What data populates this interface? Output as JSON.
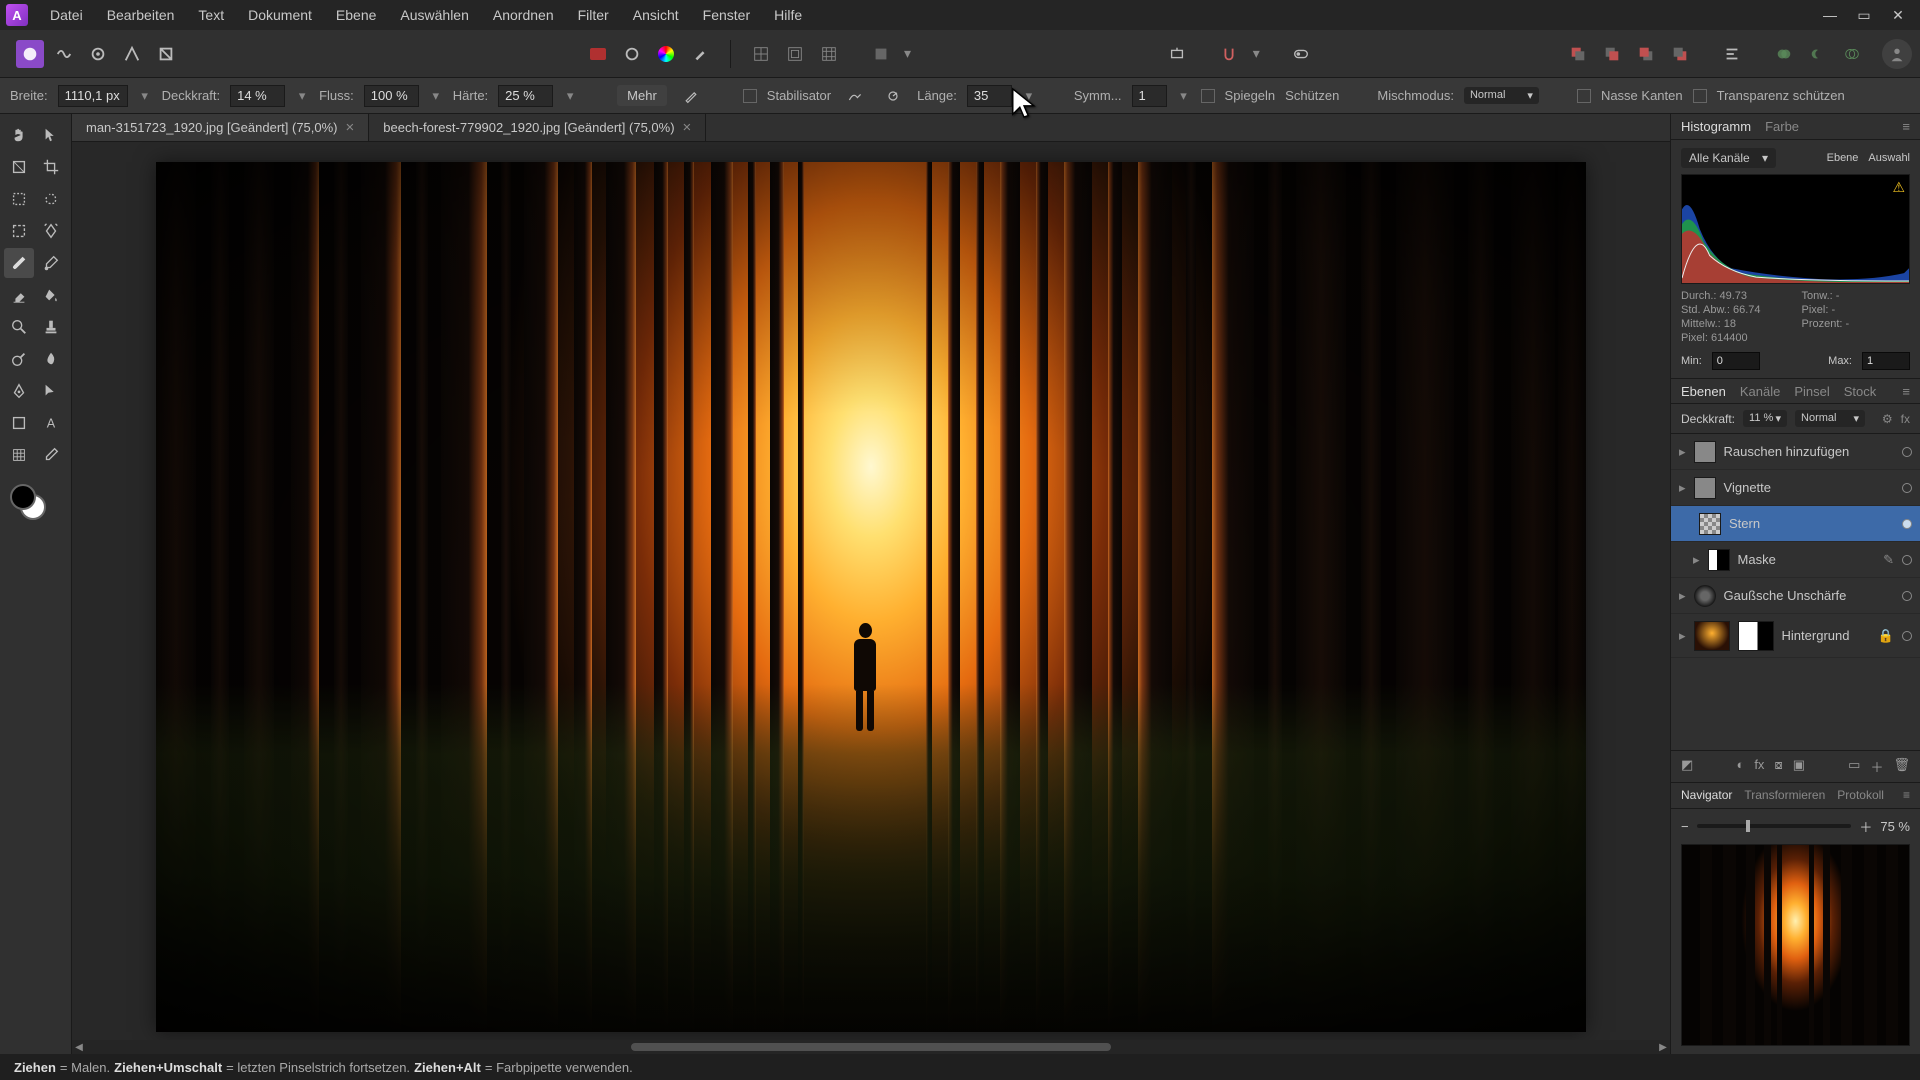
{
  "menu": [
    "Datei",
    "Bearbeiten",
    "Text",
    "Dokument",
    "Ebene",
    "Auswählen",
    "Anordnen",
    "Filter",
    "Ansicht",
    "Fenster",
    "Hilfe"
  ],
  "context": {
    "breite_l": "Breite:",
    "breite_v": "1110,1 px",
    "deckkraft_l": "Deckkraft:",
    "deckkraft_v": "14 %",
    "fluss_l": "Fluss:",
    "fluss_v": "100 %",
    "haerte_l": "Härte:",
    "haerte_v": "25 %",
    "mehr": "Mehr",
    "stabil": "Stabilisator",
    "laenge_l": "Länge:",
    "laenge_v": "35",
    "symm_l": "Symm...",
    "symm_v": "1",
    "spiegeln": "Spiegeln",
    "schuetzen": "Schützen",
    "misch_l": "Mischmodus:",
    "misch_v": "Normal",
    "nasse": "Nasse Kanten",
    "transp": "Transparenz schützen"
  },
  "tabs": [
    {
      "label": "man-3151723_1920.jpg [Geändert] (75,0%)",
      "active": true
    },
    {
      "label": "beech-forest-779902_1920.jpg [Geändert] (75,0%)",
      "active": false
    }
  ],
  "histogram": {
    "tab1": "Histogramm",
    "tab2": "Farbe",
    "channels": "Alle Kanäle",
    "ebene": "Ebene",
    "auswahl": "Auswahl",
    "stats": {
      "durch": "Durch.: 49.73",
      "tonw": "Tonw.: -",
      "stdabw": "Std. Abw.: 66.74",
      "pixel2": "Pixel: -",
      "mittelw": "Mittelw.: 18",
      "prozent": "Prozent: -",
      "pixel": "Pixel: 614400"
    },
    "min_l": "Min:",
    "min_v": "0",
    "max_l": "Max:",
    "max_v": "1"
  },
  "layers_panel": {
    "tabs": [
      "Ebenen",
      "Kanäle",
      "Pinsel",
      "Stock"
    ],
    "deck_l": "Deckkraft:",
    "deck_v": "11 %",
    "blend": "Normal",
    "items": [
      {
        "name": "Rauschen hinzufügen"
      },
      {
        "name": "Vignette"
      },
      {
        "name": "Stern"
      },
      {
        "name": "Maske"
      },
      {
        "name": "Gaußsche Unschärfe"
      },
      {
        "name": "Hintergrund"
      }
    ]
  },
  "navigator": {
    "tabs": [
      "Navigator",
      "Transformieren",
      "Protokoll"
    ],
    "zoom": "75 %"
  },
  "status": {
    "z1": "Ziehen",
    "e1": " = Malen. ",
    "z2": "Ziehen+Umschalt",
    "e2": " = letzten Pinselstrich fortsetzen. ",
    "z3": "Ziehen+Alt",
    "e3": " = Farbpipette verwenden."
  }
}
